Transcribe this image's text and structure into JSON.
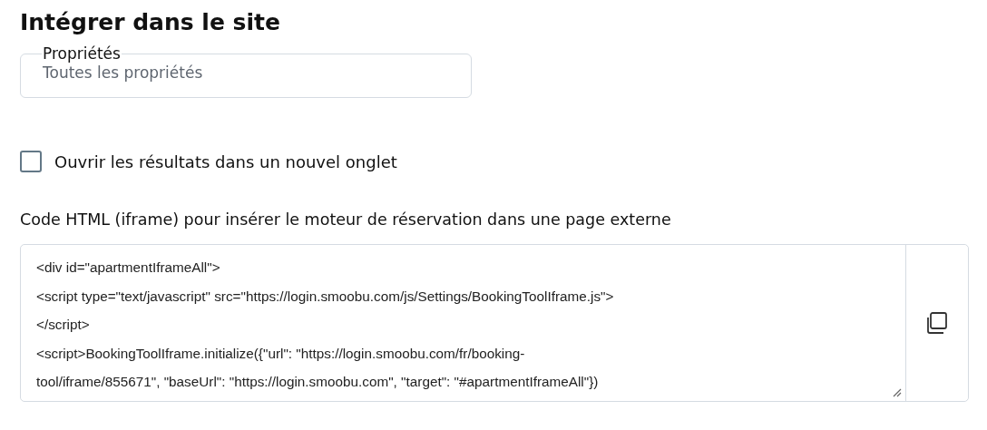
{
  "title": "Intégrer dans le site",
  "properties_field": {
    "label": "Propriétés",
    "value": "Toutes les propriétés"
  },
  "new_tab_checkbox": {
    "label": "Ouvrir les résultats dans un nouvel onglet",
    "checked": false
  },
  "code_section": {
    "label": "Code HTML (iframe) pour insérer le moteur de réservation dans une page externe",
    "lines": [
      "<div id=\"apartmentIframeAll\">",
      "<script type=\"text/javascript\" src=\"https://login.smoobu.com/js/Settings/BookingToolIframe.js\">",
      "</script>",
      "<script>BookingToolIframe.initialize({\"url\": \"https://login.smoobu.com/fr/booking-",
      "tool/iframe/855671\", \"baseUrl\": \"https://login.smoobu.com\", \"target\": \"#apartmentIframeAll\"})"
    ]
  }
}
